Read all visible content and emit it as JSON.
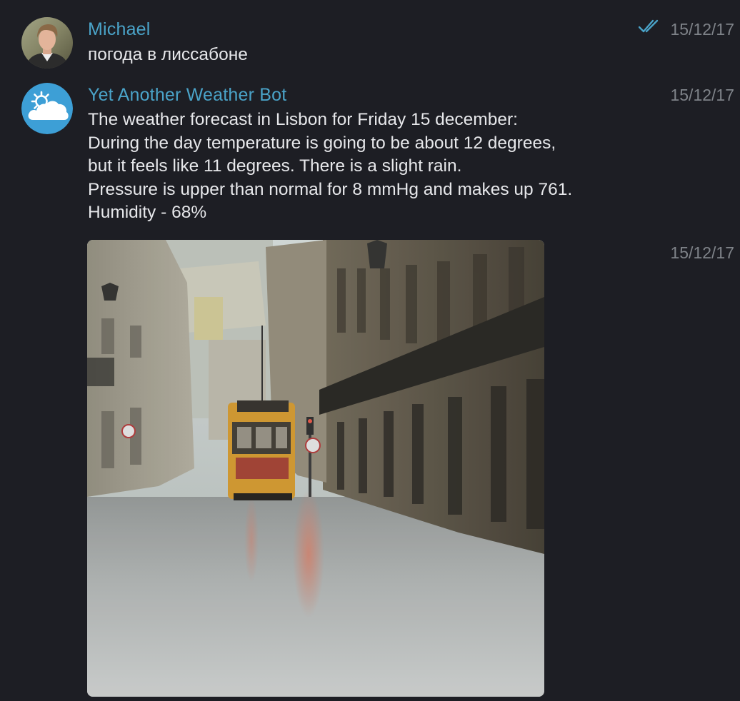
{
  "messages": [
    {
      "sender": "Michael",
      "time": "15/12/17",
      "lines": [
        "погода в лиссабоне"
      ],
      "status": "read-double-check-icon"
    },
    {
      "sender": "Yet Another Weather Bot",
      "time": "15/12/17",
      "lines": [
        "The weather forecast in Lisbon for Friday 15 december:",
        "During the day temperature is going to be about 12 degrees,",
        "but it feels like 11 degrees. There is a slight rain.",
        "Pressure is upper than normal for 8 mmHg and makes up 761.",
        "Humidity - 68%"
      ]
    },
    {
      "time": "15/12/17",
      "photo": {
        "subject": "rainy-lisbon-street-tram-photo"
      }
    }
  ],
  "colors": {
    "background": "#1d1e24",
    "sender": "#4aa3c8",
    "text": "#e6e7ea",
    "time": "#7f8389",
    "bot_avatar": "#3d9fd6"
  }
}
